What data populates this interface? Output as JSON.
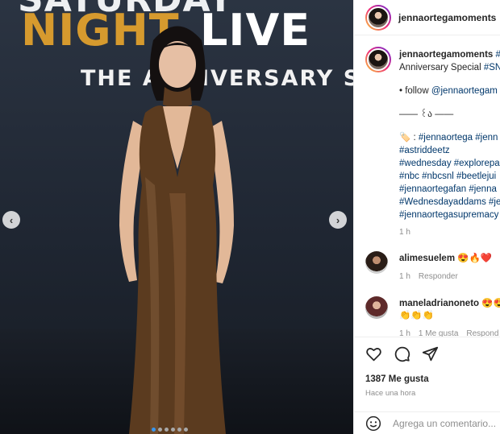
{
  "post_image": {
    "backdrop_line1": "SATURDAY",
    "backdrop_night": "NIGHT",
    "backdrop_live": "LIVE",
    "backdrop_anniversary": "THE ANNIVERSARY S",
    "prev_icon": "chevron-left",
    "next_icon": "chevron-right",
    "carousel_dots": 6,
    "active_dot": 0
  },
  "header": {
    "username": "jennaortegamoments"
  },
  "caption": {
    "username": "jennaortegamoments",
    "text_start": " #",
    "line2_plain": "Anniversary Special ",
    "line2_tag": "#SN",
    "follow_prefix": "• follow ",
    "follow_handle": "@jennaortegam",
    "divider": "—— ꒰ა ——",
    "tags_line1_prefix": "🏷️ : ",
    "tags_line1": "#jennaortega #jenn",
    "tags_line2": "#astriddeetz",
    "tags_line3": "#wednesday #explorepa",
    "tags_line4": "#nbc #nbcsnl #beetlejui",
    "tags_line5": "#jennaortegafan #jenna",
    "tags_line6": "#Wednesdayaddams #je",
    "tags_line7": "#jennaortegasupremacy",
    "time": "1 h"
  },
  "comments": [
    {
      "username": "alimesuelem",
      "text": " 😍🔥❤️",
      "time": "1 h",
      "reply": "Responder"
    },
    {
      "username": "maneladrianoneto",
      "text": " 😍😍",
      "line2": "👏👏👏",
      "time": "1 h",
      "likes": "1 Me gusta",
      "reply": "Respond"
    }
  ],
  "actions": {
    "like_icon": "heart-icon",
    "comment_icon": "comment-icon",
    "share_icon": "share-icon",
    "likes_count": "1387 Me gusta",
    "posted_ago": "Hace una hora",
    "comment_placeholder": "Agrega un comentario..."
  },
  "colors": {
    "link": "#00376b",
    "accent_gold": "#d69a2e",
    "dot_active": "#3897f0"
  }
}
